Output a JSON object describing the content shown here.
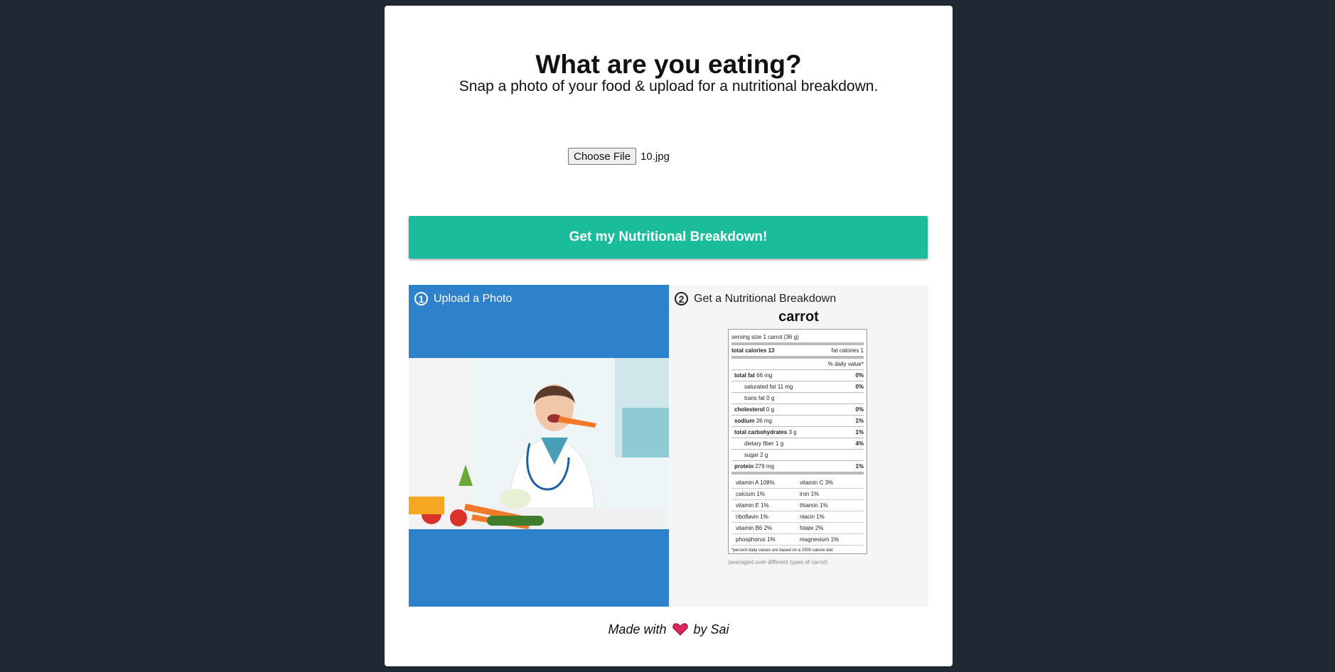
{
  "header": {
    "title": "What are you eating?",
    "subtitle": "Snap a photo of your food & upload for a nutritional breakdown."
  },
  "upload": {
    "button_label": "Choose File",
    "file_name": "10.jpg"
  },
  "cta_label": "Get my Nutritional Breakdown!",
  "steps": {
    "step1": {
      "number": "1",
      "label": "Upload a Photo"
    },
    "step2": {
      "number": "2",
      "label": "Get a Nutritional Breakdown"
    }
  },
  "nutrition": {
    "food": "carrot",
    "serving_size": "serving size 1 carrot (36 g)",
    "total_calories": "total calories 13",
    "fat_calories": "fat calories 1",
    "daily_value_header": "% daily value*",
    "rows": [
      {
        "label": "total fat",
        "amount": "66 mg",
        "pct": "0%"
      },
      {
        "label": "saturated fat",
        "amount": "11 mg",
        "pct": "0%"
      },
      {
        "label": "trans fat",
        "amount": "0 g",
        "pct": ""
      },
      {
        "label": "cholesterol",
        "amount": "0 g",
        "pct": "0%"
      },
      {
        "label": "sodium",
        "amount": "26 mg",
        "pct": "1%"
      },
      {
        "label": "total carbohydrates",
        "amount": "3 g",
        "pct": "1%"
      },
      {
        "label": "dietary fiber",
        "amount": "1 g",
        "pct": "4%"
      },
      {
        "label": "sugar",
        "amount": "2 g",
        "pct": ""
      },
      {
        "label": "protein",
        "amount": "279 mg",
        "pct": "1%"
      }
    ],
    "vitamins": [
      [
        "vitamin A 108%",
        "vitamin C 3%"
      ],
      [
        "calcium 1%",
        "iron 1%"
      ],
      [
        "vitamin E 1%",
        "thiamin 1%"
      ],
      [
        "riboflavin 1%",
        "niacin 1%"
      ],
      [
        "vitamin B6 2%",
        "folate 2%"
      ],
      [
        "phosphorus 1%",
        "magnesium 1%"
      ]
    ],
    "footnote": "*percent daily values are based on a 2000 calorie diet",
    "averaged_note": "(averaged over different types of carrot)"
  },
  "footer": {
    "made_with": "Made with",
    "by": "by Sai"
  },
  "colors": {
    "background": "#1f2833",
    "accent": "#1abc9c",
    "step1": "#2d82cb",
    "heart": "#e0245e"
  }
}
